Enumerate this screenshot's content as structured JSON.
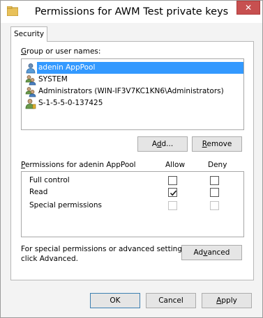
{
  "window": {
    "title": "Permissions for AWM Test private keys",
    "close_glyph": "✕"
  },
  "tabs": [
    {
      "label": "Security",
      "selected": true
    }
  ],
  "group_section": {
    "label_prefix": "",
    "label_accel": "G",
    "label_rest": "roup or user names:",
    "users": [
      {
        "name": "adenin AppPool",
        "icon": "user-icon",
        "selected": true
      },
      {
        "name": "SYSTEM",
        "icon": "group-icon",
        "selected": false
      },
      {
        "name": "Administrators (WIN-IF3V7KC1KN6\\Administrators)",
        "icon": "group-icon",
        "selected": false
      },
      {
        "name": "S-1-5-5-0-137425",
        "icon": "user-icon",
        "selected": false
      }
    ]
  },
  "buttons": {
    "add_pre": "A",
    "add_accel": "d",
    "add_post": "d...",
    "remove_accel": "R",
    "remove_post": "emove",
    "advanced_pre": "Ad",
    "advanced_accel": "v",
    "advanced_post": "anced",
    "ok": "OK",
    "cancel": "Cancel",
    "apply_accel": "A",
    "apply_post": "pply"
  },
  "permissions": {
    "label_prefix": "",
    "label_accel": "P",
    "label_rest": "ermissions for adenin AppPool",
    "allow_header": "Allow",
    "deny_header": "Deny",
    "rows": [
      {
        "name": "Full control",
        "allow": false,
        "deny": false,
        "disabled": false
      },
      {
        "name": "Read",
        "allow": true,
        "deny": false,
        "disabled": false
      },
      {
        "name": "Special permissions",
        "allow": false,
        "deny": false,
        "disabled": true
      }
    ]
  },
  "advanced_note_line1": "For special permissions or advanced settings,",
  "advanced_note_line2": "click Advanced."
}
